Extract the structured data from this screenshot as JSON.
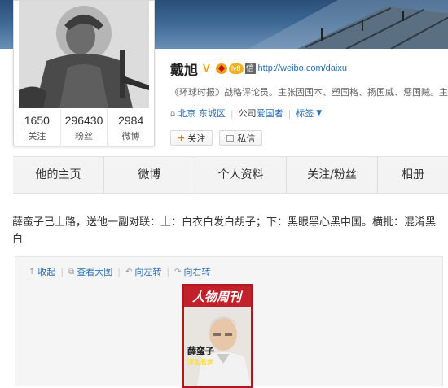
{
  "profile": {
    "name": "戴旭",
    "badges": {
      "v_label": "V",
      "level_label": "lv8",
      "xin_label": "信"
    },
    "url": "http://weibo.com/daixu",
    "description": "《环球时报》战略评论员。主张固国本、塑国格、扬国威、惩国贼。主",
    "location": "北京 东城区",
    "company": "公司",
    "company_name": "爱国者",
    "tags_label": "标签",
    "stats": [
      {
        "value": "1650",
        "label": "关注"
      },
      {
        "value": "296430",
        "label": "粉丝"
      },
      {
        "value": "2984",
        "label": "微博"
      }
    ],
    "follow_label": "关注",
    "message_label": "私信"
  },
  "tabs": [
    {
      "label": "他的主页"
    },
    {
      "label": "微博"
    },
    {
      "label": "个人资料"
    },
    {
      "label": "关注/粉丝"
    },
    {
      "label": "相册"
    }
  ],
  "post": {
    "text": "薛蛮子已上路，送他一副对联：上：白衣白发白胡子；下：黑眼黑心黑中国。横批：混淆黑白",
    "toolbar": [
      {
        "icon": "collapse-icon",
        "label": "收起"
      },
      {
        "icon": "zoom-icon",
        "label": "查看大图"
      },
      {
        "icon": "rotate-left-icon",
        "label": "向左转"
      },
      {
        "icon": "rotate-right-icon",
        "label": "向右转"
      }
    ],
    "magazine": {
      "logo": "人物周刊",
      "headline": "薛蛮子",
      "subheadline": "浮生若梦"
    }
  },
  "colors": {
    "link": "#2a6fb5",
    "magazine_red": "#b01820",
    "badge_orange": "#f0b020"
  }
}
